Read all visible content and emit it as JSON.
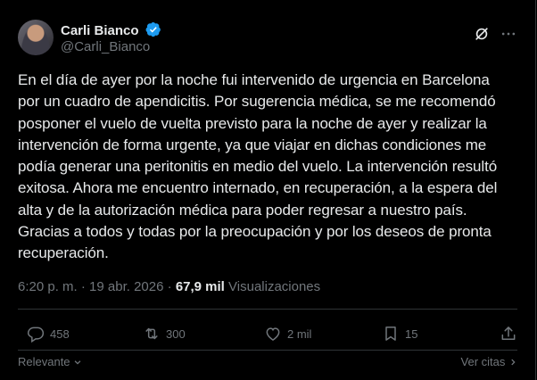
{
  "author": {
    "name": "Carli Bianco",
    "handle": "@Carli_Bianco",
    "verified": true
  },
  "icons": {
    "verified": "verified-badge-icon",
    "grok": "grok-icon",
    "more": "more-horizontal-icon",
    "reply": "reply-icon",
    "repost": "repost-icon",
    "like": "heart-icon",
    "bookmark": "bookmark-icon",
    "share": "share-icon"
  },
  "tweet": {
    "text": "En el día de ayer por la noche fui intervenido de urgencia en Barcelona\npor un cuadro de apendicitis. Por sugerencia médica, se me recomendó\nposponer el vuelo de vuelta previsto para la noche de ayer y realizar la\nintervención de forma urgente, ya que viajar en dichas condiciones me\npodía generar una peritonitis en medio del vuelo. La intervención resultó\nexitosa. Ahora me encuentro internado, en recuperación, a la espera del\nalta y de la autorización médica para poder regresar a nuestro país.\nGracias a todos y todas por la preocupación y por los deseos de pronta\nrecuperación.",
    "time": "6:20 p. m.",
    "dot": "·",
    "date": "19 abr. 2026",
    "views_count": "67,9 mil",
    "views_label": "Visualizaciones"
  },
  "stats": {
    "replies": "458",
    "reposts": "300",
    "likes": "2 mil",
    "bookmarks": "15"
  },
  "footer": {
    "relevant": "Relevante",
    "quotes": "Ver citas"
  },
  "colors": {
    "background": "#000000",
    "text": "#e7e9ea",
    "muted": "#71767b",
    "verified": "#1d9bf0",
    "border": "#2f3336"
  }
}
